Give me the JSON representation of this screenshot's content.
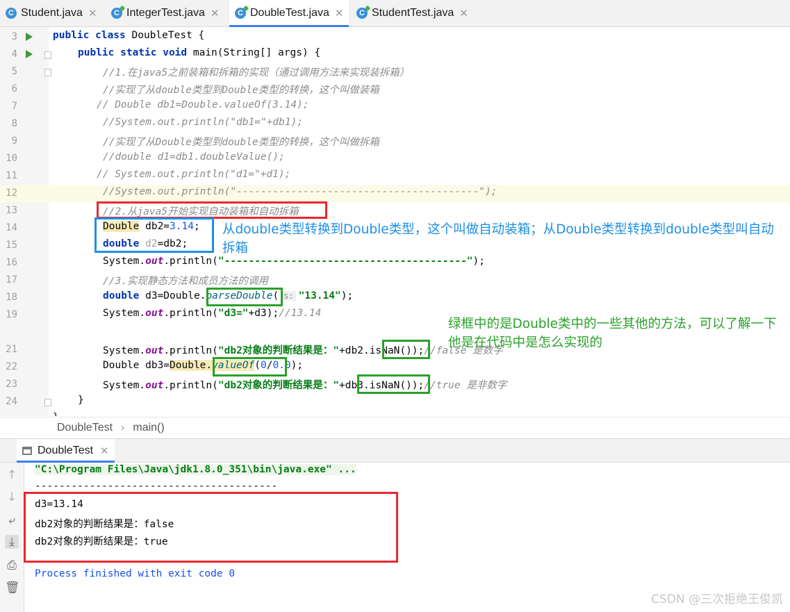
{
  "tabs": [
    {
      "label": "Student.java",
      "icon": "class-icon",
      "active": false
    },
    {
      "label": "IntegerTest.java",
      "icon": "test-class-icon",
      "active": false
    },
    {
      "label": "DoubleTest.java",
      "icon": "test-class-icon",
      "active": true
    },
    {
      "label": "StudentTest.java",
      "icon": "test-class-icon",
      "active": false
    }
  ],
  "editor": {
    "line_numbers": [
      "3",
      "4",
      "5",
      "6",
      "7",
      "8",
      "9",
      "10",
      "11",
      "12",
      "13",
      "14",
      "15",
      "16",
      "17",
      "18",
      "19",
      "",
      "21",
      "22",
      "23",
      "24"
    ]
  },
  "breadcrumb": {
    "class_name": "DoubleTest",
    "method_name": "main()",
    "separator": "›"
  },
  "run_panel": {
    "tab_label": "DoubleTest",
    "command": "\"C:\\Program Files\\Java\\jdk1.8.0_351\\bin\\java.exe\" ...",
    "separator_line": "----------------------------------------",
    "output_lines": [
      "d3=13.14",
      "db2对象的判断结果是：false",
      "db2对象的判断结果是：true"
    ],
    "exit_message": "Process finished with exit code 0"
  },
  "annotations": {
    "blue_note": "从double类型转换到Double类型，这个叫做自动装箱；从Double类型转换到double类型叫自动拆箱",
    "green_note": "绿框中的是Double类中的一些其他的方法，可以了解一下他是在代码中是怎么实现的",
    "colors": {
      "red": "#e8282d",
      "blue": "#1e8fe6",
      "green": "#2aa12a"
    }
  },
  "watermark": "CSDN @三次拒绝王俊凯"
}
